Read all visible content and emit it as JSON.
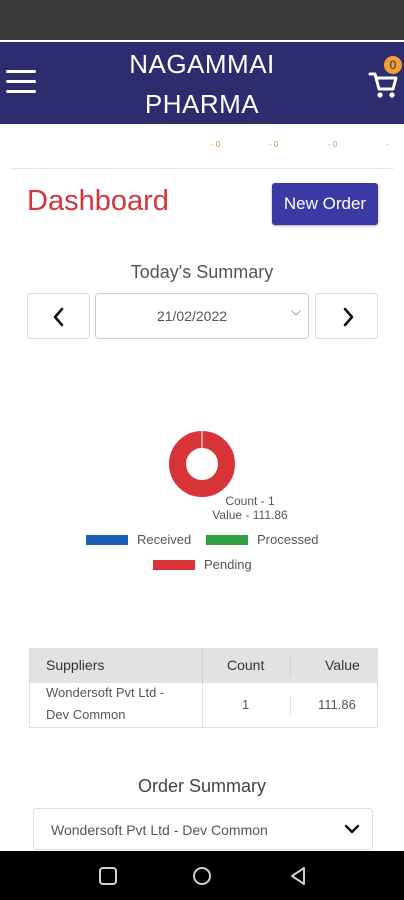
{
  "header": {
    "brand_line1": "NAGAMMAI",
    "brand_line2": "PHARMA",
    "cart_count": "0",
    "icons": {
      "menu": "hamburger-menu-icon",
      "cart": "cart-icon"
    }
  },
  "ticker": {
    "items": [
      "- 0",
      "- 0",
      "- 0",
      "-"
    ]
  },
  "dashboard": {
    "title": "Dashboard",
    "new_order_label": "New Order"
  },
  "todays_summary": {
    "title": "Today's Summary",
    "date": "21/02/2022"
  },
  "chart_data": {
    "type": "pie",
    "title": "",
    "series": [
      {
        "name": "Received",
        "value": 0,
        "color": "#1a5fb4"
      },
      {
        "name": "Processed",
        "value": 0,
        "color": "#2ea043"
      },
      {
        "name": "Pending",
        "value": 1,
        "color": "#d9333a"
      }
    ],
    "annotations": [
      "Count - 1",
      "Value - 111.86"
    ],
    "legend_placement": "bottom"
  },
  "legend": {
    "received": "Received",
    "processed": "Processed",
    "pending": "Pending"
  },
  "suppliers_table": {
    "headers": [
      "Suppliers",
      "Count",
      "Value"
    ],
    "rows": [
      {
        "supplier_line1": "Wondersoft Pvt Ltd -",
        "supplier_line2": "Dev Common",
        "count": "1",
        "value": "111.86"
      }
    ]
  },
  "order_summary": {
    "title": "Order Summary",
    "selected_supplier": "Wondersoft Pvt Ltd - Dev Common"
  },
  "colors": {
    "header_bg": "#2e2c6f",
    "accent_red": "#d9333a",
    "button_blue": "#3b39a6",
    "badge_orange": "#f0a030"
  }
}
